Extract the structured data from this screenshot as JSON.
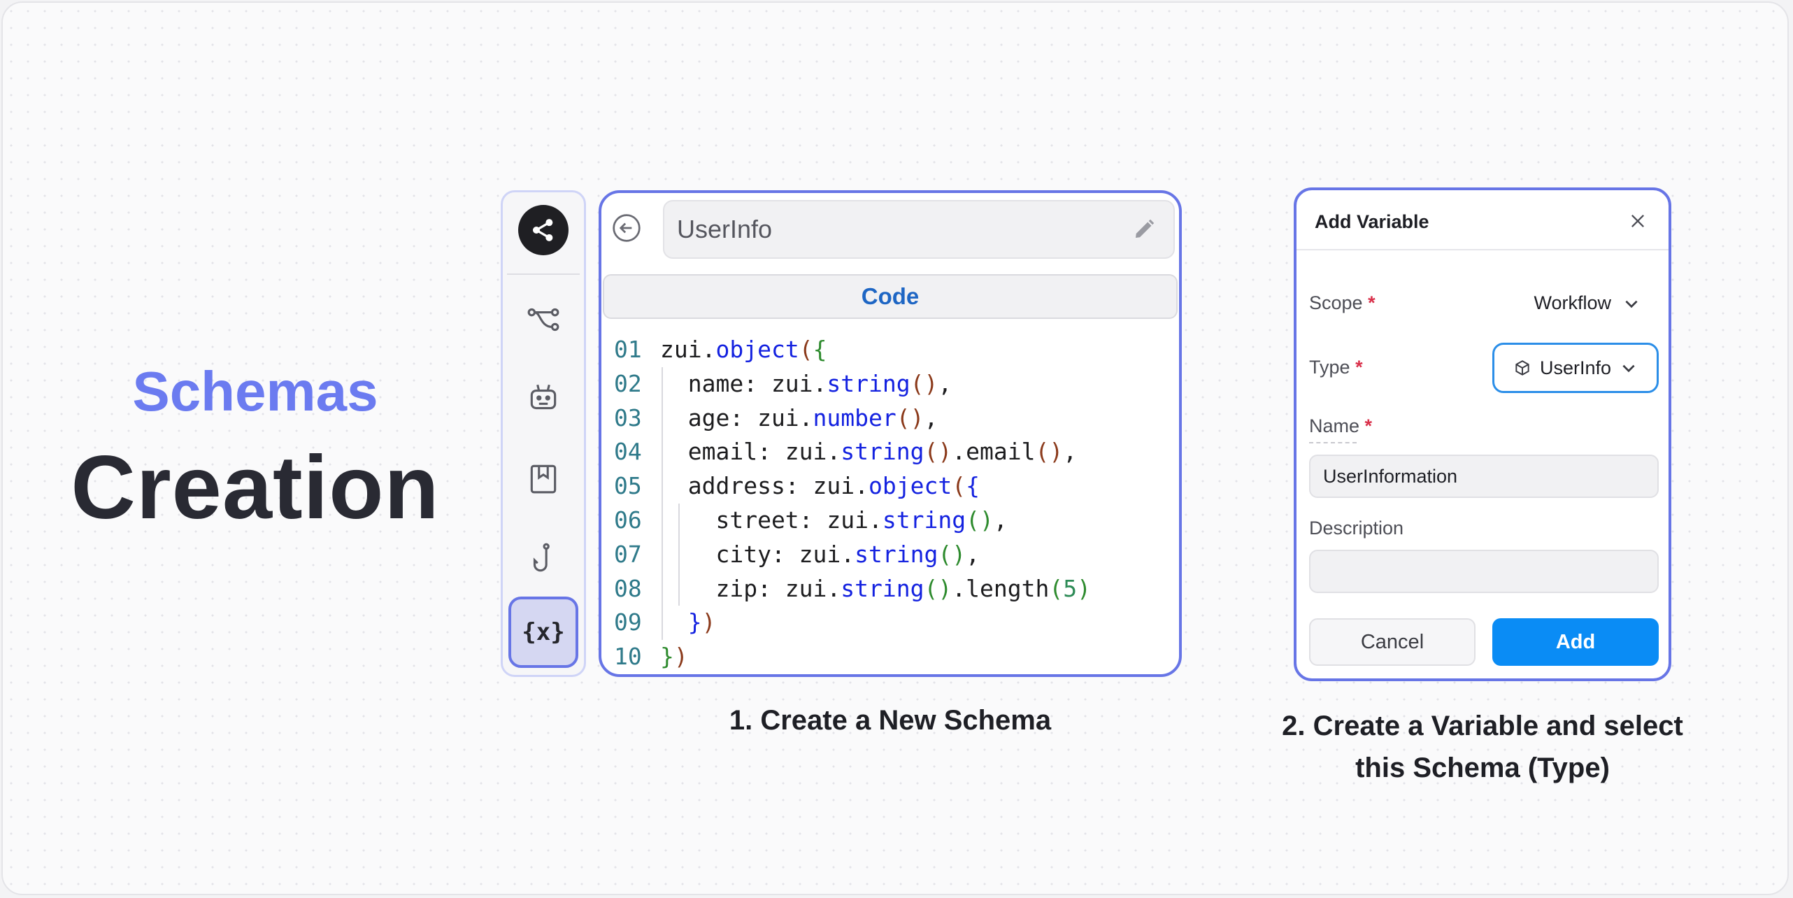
{
  "hero": {
    "subtitle": "Schemas",
    "title": "Creation"
  },
  "sidebar": {
    "items": [
      "share-logo",
      "workflow-icon",
      "bot-icon",
      "bookmark-icon",
      "hook-icon",
      "variables-icon"
    ],
    "active_label": "{x}"
  },
  "editor": {
    "schema_name": "UserInfo",
    "tab_label": "Code",
    "line_numbers": [
      "01",
      "02",
      "03",
      "04",
      "05",
      "06",
      "07",
      "08",
      "09",
      "10"
    ]
  },
  "caption1": "1. Create a New Schema",
  "dialog": {
    "title": "Add Variable",
    "scope_label": "Scope",
    "scope_value": "Workflow",
    "type_label": "Type",
    "type_value": "UserInfo",
    "name_label": "Name",
    "name_value": "UserInformation",
    "description_label": "Description",
    "description_value": "",
    "required_mark": "*",
    "cancel_label": "Cancel",
    "add_label": "Add"
  },
  "caption2": {
    "line1": "2. Create a Variable and select",
    "line2": "this Schema (Type)"
  },
  "colors": {
    "accent": "#6775e6",
    "primary_button": "#0a8cf5",
    "hero_subtitle": "#6b7bf0"
  }
}
